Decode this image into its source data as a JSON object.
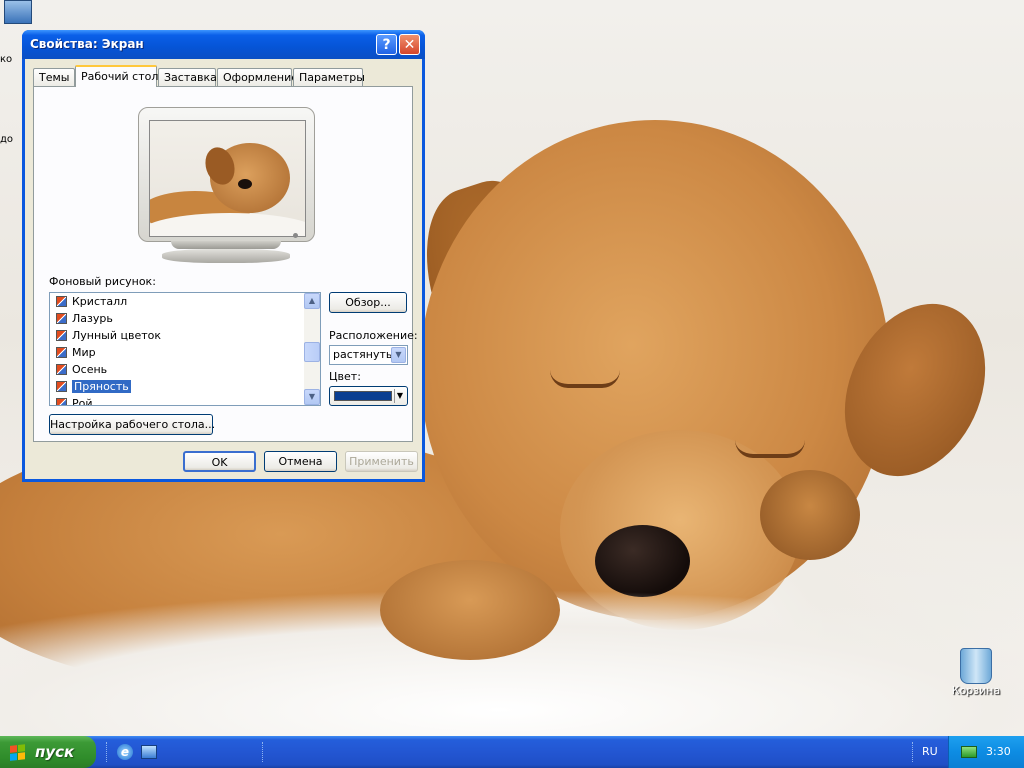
{
  "desktop": {
    "recycle_bin_label": "Корзина",
    "my_computer_label_partial": "ко",
    "other_label_partial": "до"
  },
  "dialog": {
    "title": "Свойства: Экран",
    "help_glyph": "?",
    "close_glyph": "✕",
    "tabs": [
      {
        "label": "Темы",
        "active": false
      },
      {
        "label": "Рабочий стол",
        "active": true
      },
      {
        "label": "Заставка",
        "active": false
      },
      {
        "label": "Оформление",
        "active": false
      },
      {
        "label": "Параметры",
        "active": false
      }
    ],
    "background_label": "Фоновый рисунок:",
    "background_items": [
      "Кристалл",
      "Лазурь",
      "Лунный цветок",
      "Мир",
      "Осень",
      "Пряность",
      "Рой"
    ],
    "selected_item": "Пряность",
    "browse_label": "Обзор...",
    "position_label": "Расположение:",
    "position_value": "растянуть",
    "color_label": "Цвет:",
    "color_value": "#0b3f91",
    "customize_label": "Настройка рабочего стола...",
    "ok_label": "OK",
    "cancel_label": "Отмена",
    "apply_label": "Применить"
  },
  "taskbar": {
    "start_label": "пуск",
    "language": "RU",
    "clock": "3:30"
  },
  "colors": {
    "titlebar_blue": "#0a58de",
    "taskbar_blue": "#245edb",
    "start_green": "#3c9a36",
    "selection_blue": "#316ac5"
  }
}
